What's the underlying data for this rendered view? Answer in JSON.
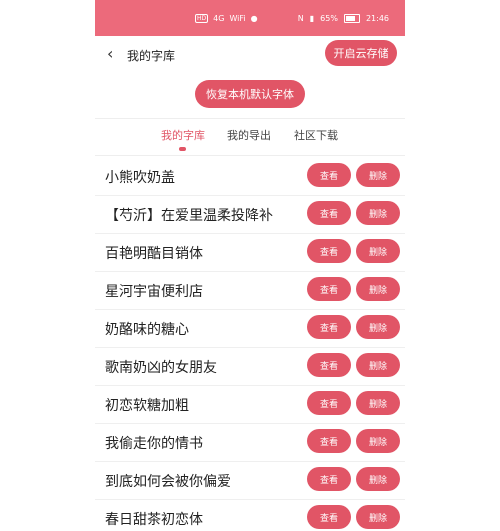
{
  "status": {
    "hd": "HD",
    "signal": "4G",
    "wifi": "WiFi",
    "battery": "65%",
    "time": "21:46"
  },
  "header": {
    "back_icon": "chevron-left-icon",
    "title": "我的字库",
    "cloud_button": "开启云存储"
  },
  "restore_button": "恢复本机默认字体",
  "tabs": [
    {
      "label": "我的字库",
      "active": true
    },
    {
      "label": "我的导出"
    },
    {
      "label": "社区下载"
    }
  ],
  "fonts": [
    {
      "name": "小熊吹奶盖"
    },
    {
      "name": "【芍沂】在爱里温柔投降补"
    },
    {
      "name": "百艳明酷目销体"
    },
    {
      "name": "星河宇宙便利店"
    },
    {
      "name": "奶酪味的糖心"
    },
    {
      "name": "歌南奶凶的女朋友"
    },
    {
      "name": "初恋软糖加粗"
    },
    {
      "name": "我偷走你的情书"
    },
    {
      "name": "到底如何会被你偏爱"
    },
    {
      "name": "春日甜茶初恋体"
    }
  ],
  "row_buttons": {
    "view": "查看",
    "delete": "删除"
  },
  "colors": {
    "accent": "#e15566",
    "status_bar": "#ec6a7b"
  }
}
